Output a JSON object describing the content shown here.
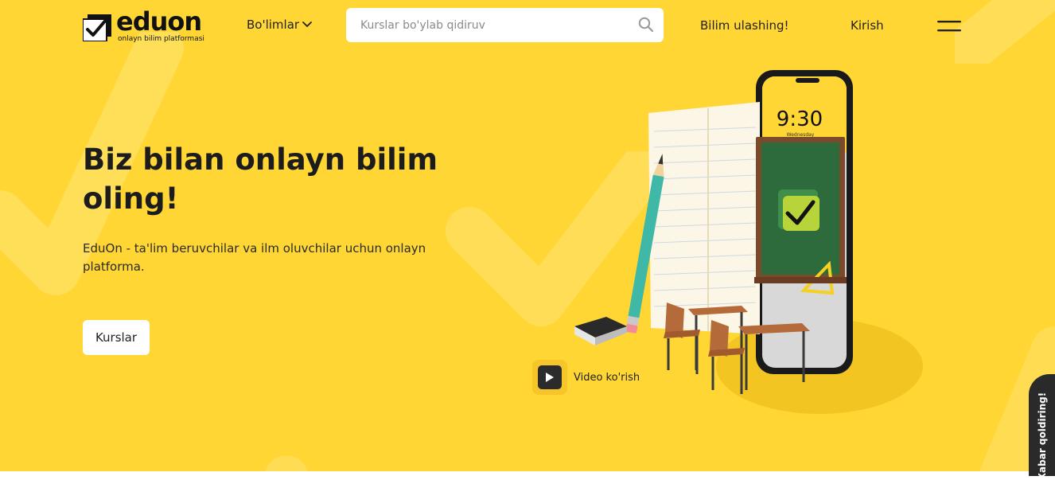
{
  "brand": {
    "name": "eduon",
    "tagline": "onlayn bilim platformasi"
  },
  "nav": {
    "sections_label": "Bo'limlar",
    "share_label": "Bilim ulashing!",
    "login_label": "Kirish"
  },
  "search": {
    "placeholder": "Kurslar bo'ylab qidiruv",
    "value": ""
  },
  "hero": {
    "title": "Biz bilan onlayn bilim oling!",
    "description": "EduOn - ta'lim beruvchilar va ilm oluvchilar uchun onlayn platforma.",
    "button_label": "Kurslar"
  },
  "illustration": {
    "phone_time": "9:30",
    "phone_day": "Wednesday"
  },
  "video": {
    "label": "Video ko'rish"
  },
  "feedback": {
    "label": "Xabar qoldiring!"
  },
  "icons": {
    "logo": "checkmark-logo-icon",
    "sections_dropdown": "chevron-down-icon",
    "search": "search-icon",
    "menu": "hamburger-menu-icon",
    "video": "play-icon"
  },
  "colors": {
    "hero_background": "#ffd633",
    "text_dark": "#1c1c1c",
    "surface": "#ffffff",
    "dark_button": "#2b2b2b",
    "board_green": "#2e6b3c"
  }
}
